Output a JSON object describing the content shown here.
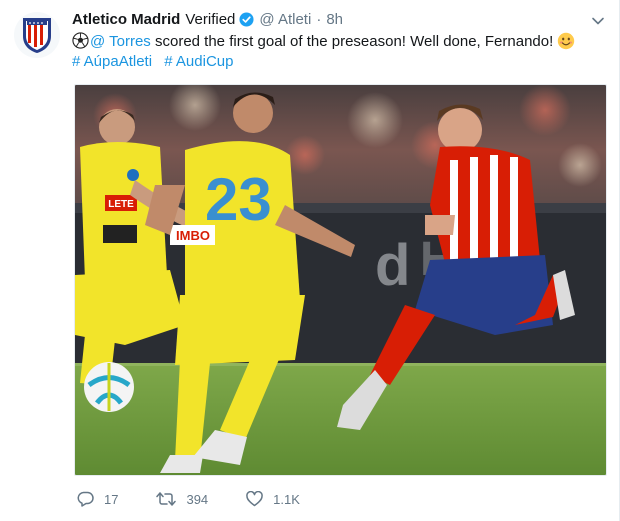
{
  "tweet": {
    "author_name": "Atletico Madrid",
    "verified_label": "Verified",
    "handle": "@ Atleti",
    "separator": "·",
    "time": "8h",
    "mention": "@ Torres",
    "body": " scored the first goal of the preseason! Well done, Fernando!",
    "hashtags": [
      "# AúpaAtleti",
      "# AudiCup"
    ],
    "jersey_number": "23",
    "sponsor_text": "LETE",
    "sponsor_text_2": "IMBO",
    "replies": "17",
    "retweets": "394",
    "likes": "1.1K"
  },
  "icons": {
    "avatar": "atletico-crest-icon",
    "verified": "verified-badge-icon",
    "menu": "chevron-down-icon",
    "reply": "reply-icon",
    "retweet": "retweet-icon",
    "like": "heart-icon"
  },
  "colors": {
    "link": "#1b95e0",
    "text": "#14171a",
    "muted": "#657786",
    "verified": "#1da1f2",
    "atletico_red": "#d81e05",
    "atletico_blue": "#273e8a",
    "napoli_yellow": "#f2e42a",
    "pitch": "#6f9b3a"
  }
}
